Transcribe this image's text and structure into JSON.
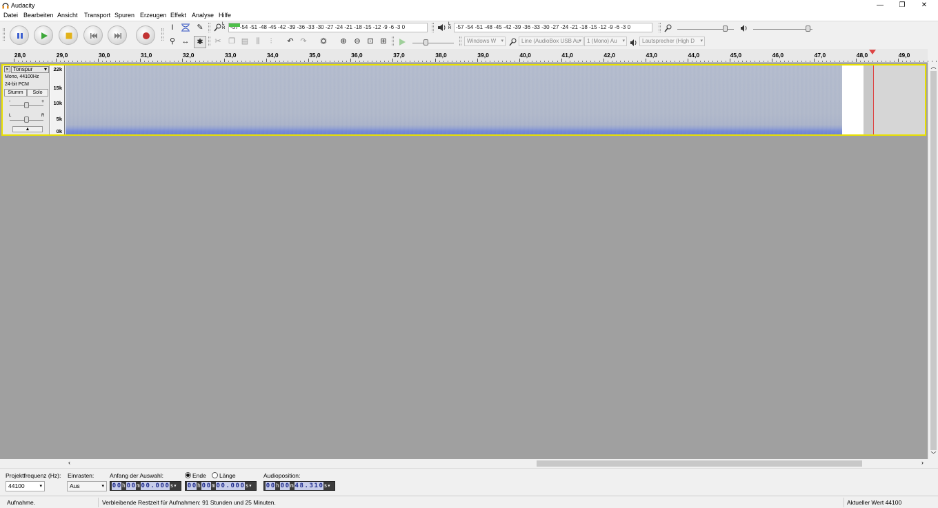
{
  "window": {
    "title": "Audacity",
    "controls": {
      "minimize": "—",
      "maximize": "❐",
      "close": "✕"
    }
  },
  "menubar": [
    "Datei",
    "Bearbeiten",
    "Ansicht",
    "Transport",
    "Spuren",
    "Erzeugen",
    "Effekt",
    "Analyse",
    "Hilfe"
  ],
  "transport": {
    "buttons": [
      "pause-icon",
      "play-icon",
      "stop-icon",
      "skip-start-icon",
      "skip-end-icon",
      "record-icon"
    ],
    "colors": {
      "play": "#3ea83a",
      "stop": "#e2b21a",
      "record": "#c23434",
      "pause": "#3c5fcf"
    }
  },
  "tools": {
    "row1": [
      "I",
      "✳",
      "✎"
    ],
    "row2": [
      "⚲",
      "↔",
      "✱"
    ]
  },
  "meters": {
    "record_ticks": "-57 -54 -51 -48 -45 -42 -39 -36 -33 -30 -27 -24 -21 -18 -15 -12  -9  -6  -3  0",
    "play_ticks": "-57 -54 -51 -48 -45 -42 -39 -36 -33 -30 -27 -24 -21 -18 -15 -12  -9  -6  -3  0",
    "record_lr": "L\nR",
    "play_lr": "L\nR"
  },
  "mixer": {
    "record_volume_level": 0.85,
    "play_volume_level": 0.93
  },
  "devices": {
    "host": "Windows W",
    "recording_device": "Line (AudioBox USB Au",
    "channels": "1 (Mono) Au",
    "playback_device": "Lautsprecher (High D"
  },
  "ruler": {
    "labels": [
      "28,0",
      "29,0",
      "30,0",
      "31,0",
      "32,0",
      "33,0",
      "34,0",
      "35,0",
      "36,0",
      "37,0",
      "38,0",
      "39,0",
      "40,0",
      "41,0",
      "42,0",
      "43,0",
      "44,0",
      "45,0",
      "46,0",
      "47,0",
      "48,0",
      "49,0"
    ]
  },
  "track": {
    "name": "Tonspur",
    "format": "Mono, 44100Hz",
    "bit_depth": "24-bit PCM",
    "mute_label": "Stumm",
    "solo_label": "Solo",
    "gain_minus": "-",
    "gain_plus": "+",
    "pan_left": "L",
    "pan_right": "R",
    "collapse_label": "▲",
    "scale_labels": [
      "22k",
      "15k",
      "10k",
      "5k",
      "0k"
    ]
  },
  "selection_bar": {
    "rate_label": "Projektfrequenz (Hz):",
    "rate_value": "44100",
    "snap_label": "Einrasten:",
    "snap_value": "Aus",
    "start_label": "Anfang der Auswahl:",
    "end_option": "Ende",
    "length_option": "Länge",
    "audio_pos_label": "Audioposition:",
    "start_time": {
      "h": "00",
      "m": "00",
      "s": "00.000"
    },
    "end_time": {
      "h": "00",
      "m": "00",
      "s": "00.000"
    },
    "audio_time": {
      "h": "00",
      "m": "00",
      "s": "48.310"
    }
  },
  "status": {
    "state": "Aufnahme.",
    "remaining": "Verbleibende Restzeit für Aufnahmen: 91 Stunden und 25 Minuten.",
    "current_value": "Aktueller Wert 44100"
  }
}
